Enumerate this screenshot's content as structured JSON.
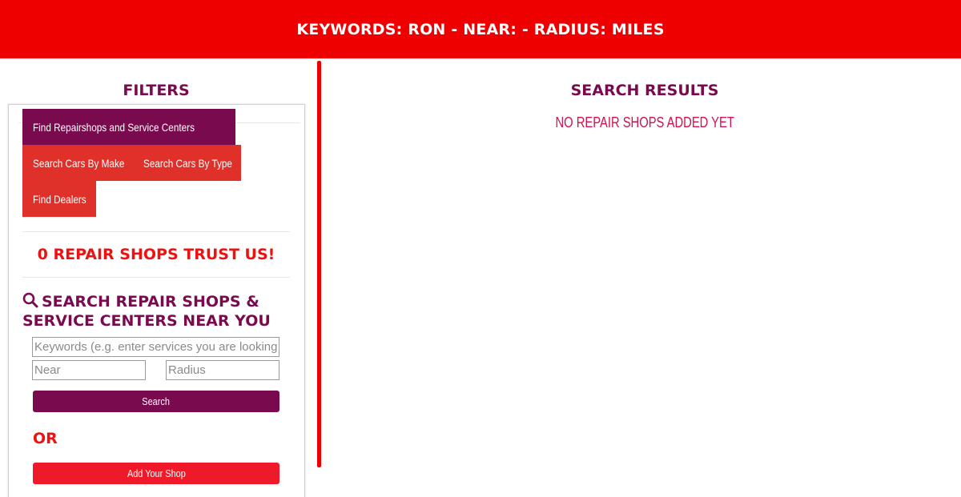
{
  "header": {
    "title": "KEYWORDS: RON - NEAR: - RADIUS: MILES"
  },
  "filters": {
    "title": "FILTERS",
    "tabs": [
      {
        "label": "Find Repairshops and Service Centers",
        "active": true
      },
      {
        "label": "Search Cars By Make",
        "active": false
      },
      {
        "label": "Search Cars By Type",
        "active": false
      },
      {
        "label": "Find Dealers",
        "active": false
      }
    ],
    "trust_text": "0 REPAIR SHOPS TRUST US!",
    "search_heading": "SEARCH REPAIR SHOPS & SERVICE CENTERS NEAR YOU",
    "search_icon": "search-icon",
    "keywords_placeholder": "Keywords (e.g. enter services you are looking for)",
    "near_placeholder": "Near",
    "radius_placeholder": "Radius",
    "search_button": "Search",
    "or_text": "OR",
    "add_shop_button": "Add Your Shop"
  },
  "results": {
    "title": "SEARCH RESULTS",
    "empty_message": "NO REPAIR SHOPS ADDED YET"
  },
  "colors": {
    "brand_red": "#ee0000",
    "plum": "#7a0a4e",
    "tab_red": "#e0302a",
    "add_button": "#f0192a"
  }
}
